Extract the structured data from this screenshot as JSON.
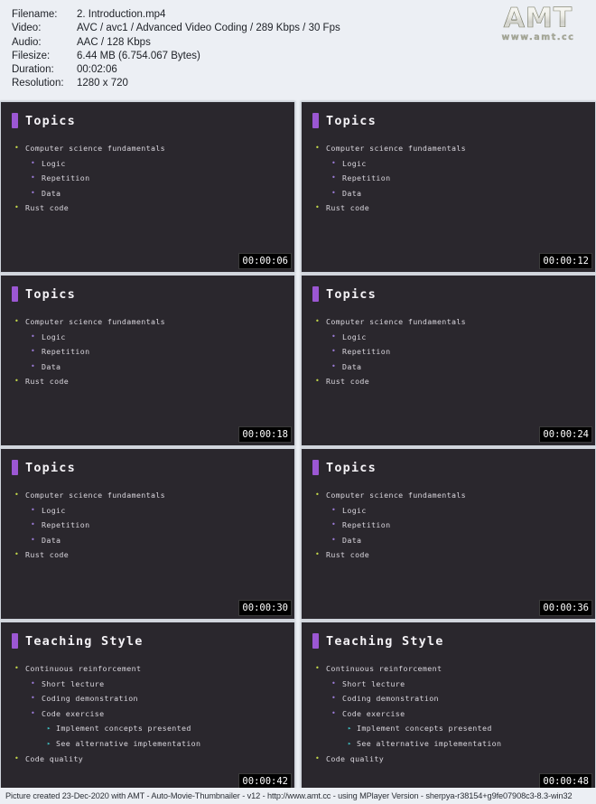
{
  "header": {
    "meta_rows": [
      {
        "key": "Filename:",
        "value": "2. Introduction.mp4"
      },
      {
        "key": "Video:",
        "value": "AVC / avc1 / Advanced Video Coding / 289 Kbps / 30 Fps"
      },
      {
        "key": "Audio:",
        "value": "AAC / 128 Kbps"
      },
      {
        "key": "Filesize:",
        "value": "6.44 MB (6.754.067 Bytes)"
      },
      {
        "key": "Duration:",
        "value": "00:02:06"
      },
      {
        "key": "Resolution:",
        "value": "1280 x 720"
      }
    ],
    "logo": {
      "mark": "AMT",
      "url": "www.amt.cc"
    }
  },
  "colors": {
    "page_background": "#eceff4",
    "tile_background": "#2a272d",
    "heading_bar": "#9b57d3",
    "bullet_level1": "#c3d84a",
    "bullet_level2": "#9b7ad6",
    "bullet_level3": "#3fc7c9",
    "timestamp_background": "#000000",
    "timestamp_text": "#ffffff"
  },
  "markers": {
    "level1": "•",
    "level2": "•",
    "level3": "▸"
  },
  "slides": {
    "topics": {
      "heading": "Topics",
      "bullets": [
        {
          "level": 1,
          "text": "Computer science fundamentals"
        },
        {
          "level": 2,
          "text": "Logic"
        },
        {
          "level": 2,
          "text": "Repetition"
        },
        {
          "level": 2,
          "text": "Data"
        },
        {
          "level": 1,
          "text": "Rust code"
        }
      ]
    },
    "teaching_style": {
      "heading": "Teaching Style",
      "bullets": [
        {
          "level": 1,
          "text": "Continuous reinforcement"
        },
        {
          "level": 2,
          "text": "Short lecture"
        },
        {
          "level": 2,
          "text": "Coding demonstration"
        },
        {
          "level": 2,
          "text": "Code exercise"
        },
        {
          "level": 3,
          "text": "Implement concepts presented"
        },
        {
          "level": 3,
          "text": "See alternative implementation"
        },
        {
          "level": 1,
          "text": "Code quality"
        }
      ]
    }
  },
  "thumbnails": [
    {
      "slide": "topics",
      "timestamp": "00:00:06"
    },
    {
      "slide": "topics",
      "timestamp": "00:00:12"
    },
    {
      "slide": "topics",
      "timestamp": "00:00:18"
    },
    {
      "slide": "topics",
      "timestamp": "00:00:24"
    },
    {
      "slide": "topics",
      "timestamp": "00:00:30"
    },
    {
      "slide": "topics",
      "timestamp": "00:00:36"
    },
    {
      "slide": "teaching_style",
      "timestamp": "00:00:42"
    },
    {
      "slide": "teaching_style",
      "timestamp": "00:00:48"
    }
  ],
  "footer": {
    "text": "Picture created 23-Dec-2020 with AMT - Auto-Movie-Thumbnailer - v12 - http://www.amt.cc - using MPlayer Version - sherpya-r38154+g9fe07908c3-8.3-win32"
  }
}
